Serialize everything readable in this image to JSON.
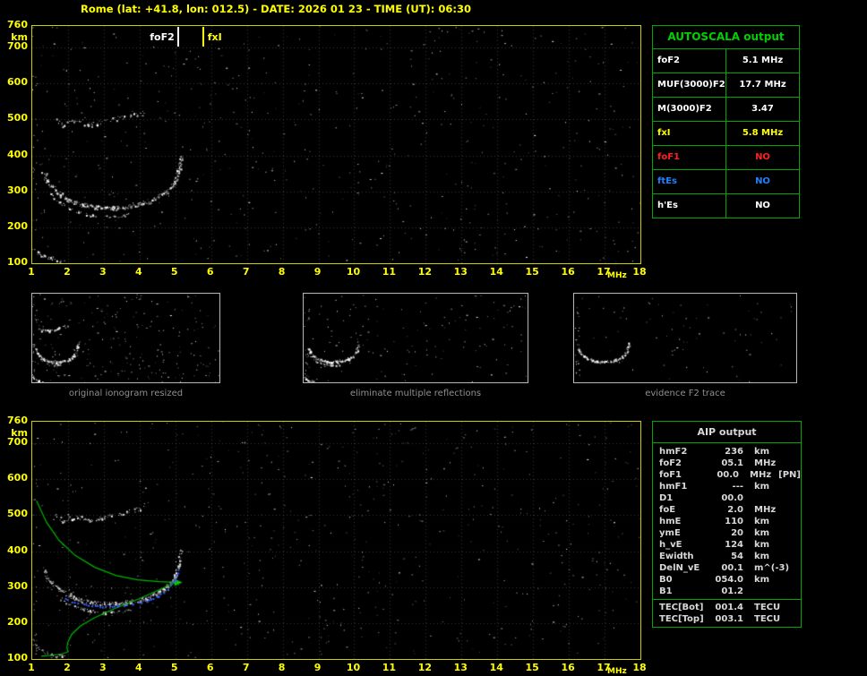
{
  "title": "Rome (lat: +41.8, lon: 012.5) - DATE: 2026 01 23 - TIME (UT): 06:30",
  "colors": {
    "axis_yellow": "#ffff00",
    "table_green": "#00a800",
    "marker_foF2": "#ffffff",
    "marker_fxI": "#ffff00",
    "profile_green": "#00b400",
    "restored_blue": "#3c5cff",
    "caption_gray": "#909090",
    "no_red": "#ff2020",
    "no_blue": "#2080ff"
  },
  "autoscala": {
    "title": "AUTOSCALA output",
    "rows": [
      {
        "label": "foF2",
        "value": "5.1 MHz",
        "color": "#ffffff"
      },
      {
        "label": "MUF(3000)F2",
        "value": "17.7 MHz",
        "color": "#ffffff"
      },
      {
        "label": "M(3000)F2",
        "value": "3.47",
        "color": "#ffffff"
      },
      {
        "label": "fxI",
        "value": "5.8 MHz",
        "color": "#ffff00"
      },
      {
        "label": "foF1",
        "value": "NO",
        "color": "#ff2020"
      },
      {
        "label": "ftEs",
        "value": "NO",
        "color": "#2080ff"
      },
      {
        "label": "h'Es",
        "value": "NO",
        "color": "#ffffff"
      }
    ]
  },
  "thumbnails": [
    {
      "caption": "original ionogram resized"
    },
    {
      "caption": "eliminate multiple reflections"
    },
    {
      "caption": "evidence F2 trace"
    }
  ],
  "aip": {
    "title": "AIP output",
    "rows": [
      {
        "label": "hmF2",
        "value": "236",
        "unit": "km",
        "extra": ""
      },
      {
        "label": "foF2",
        "value": "05.1",
        "unit": "MHz",
        "extra": ""
      },
      {
        "label": "foF1",
        "value": "00.0",
        "unit": "MHz",
        "extra": "[PN]"
      },
      {
        "label": "hmF1",
        "value": "---",
        "unit": "km",
        "extra": ""
      },
      {
        "label": "D1",
        "value": "00.0",
        "unit": "",
        "extra": ""
      },
      {
        "label": "foE",
        "value": "2.0",
        "unit": "MHz",
        "extra": ""
      },
      {
        "label": "hmE",
        "value": "110",
        "unit": "km",
        "extra": ""
      },
      {
        "label": "ymE",
        "value": "20",
        "unit": "km",
        "extra": ""
      },
      {
        "label": "h_vE",
        "value": "124",
        "unit": "km",
        "extra": ""
      },
      {
        "label": "Ewidth",
        "value": "54",
        "unit": "km",
        "extra": ""
      },
      {
        "label": "DelN_vE",
        "value": "00.1",
        "unit": "m^(-3)",
        "extra": ""
      },
      {
        "label": "B0",
        "value": "054.0",
        "unit": "km",
        "extra": ""
      },
      {
        "label": "B1",
        "value": "01.2",
        "unit": "",
        "extra": ""
      }
    ],
    "tec_rows": [
      {
        "label": "TEC[Bot]",
        "value": "001.4",
        "unit": "TECU"
      },
      {
        "label": "TEC[Top]",
        "value": "003.1",
        "unit": "TECU"
      }
    ]
  },
  "chart_data": {
    "type": "scatter",
    "title": "Ionogram with AUTOSCALA / AIP interpretation",
    "xlabel": "MHz",
    "ylabel": "km",
    "xlim": [
      1,
      18
    ],
    "ylim": [
      100,
      760
    ],
    "x_ticks": [
      1,
      2,
      3,
      4,
      5,
      6,
      7,
      8,
      9,
      10,
      11,
      12,
      13,
      14,
      15,
      16,
      17,
      18
    ],
    "y_ticks": [
      760,
      700,
      600,
      500,
      400,
      300,
      200,
      100
    ],
    "grid": true,
    "markers": [
      {
        "name": "foF2",
        "freq_mhz": 5.1,
        "color": "#ffffff"
      },
      {
        "name": "fxI",
        "freq_mhz": 5.8,
        "color": "#ffff00"
      }
    ],
    "traces": {
      "multiple_reflection_hop": [
        [
          1.65,
          498
        ],
        [
          1.85,
          486
        ],
        [
          2.05,
          492
        ],
        [
          2.3,
          497
        ],
        [
          2.55,
          486
        ],
        [
          2.8,
          490
        ],
        [
          3.05,
          497
        ],
        [
          3.3,
          503
        ],
        [
          3.6,
          509
        ],
        [
          3.9,
          516
        ],
        [
          4.1,
          521
        ]
      ],
      "f_trace_main": [
        [
          1.3,
          352
        ],
        [
          1.5,
          318
        ],
        [
          1.75,
          295
        ],
        [
          2.05,
          276
        ],
        [
          2.4,
          263
        ],
        [
          2.8,
          256
        ],
        [
          3.2,
          254
        ],
        [
          3.6,
          257
        ],
        [
          4.0,
          264
        ],
        [
          4.4,
          278
        ],
        [
          4.7,
          296
        ],
        [
          4.95,
          322
        ],
        [
          5.1,
          362
        ],
        [
          5.16,
          400
        ]
      ],
      "f_trace_inner": [
        [
          1.45,
          302
        ],
        [
          1.7,
          274
        ],
        [
          2.0,
          254
        ],
        [
          2.35,
          241
        ],
        [
          2.7,
          233
        ],
        [
          3.05,
          230
        ],
        [
          3.4,
          231
        ],
        [
          3.75,
          237
        ]
      ],
      "e_region": [
        [
          1.02,
          142
        ],
        [
          1.15,
          130
        ],
        [
          1.3,
          121
        ],
        [
          1.5,
          114
        ],
        [
          1.7,
          110
        ],
        [
          1.85,
          108
        ]
      ]
    },
    "overlays": {
      "restored_trace_blue": [
        [
          1.85,
          268
        ],
        [
          2.2,
          256
        ],
        [
          2.6,
          248
        ],
        [
          3.0,
          245
        ],
        [
          3.4,
          246
        ],
        [
          3.8,
          251
        ],
        [
          4.2,
          260
        ],
        [
          4.55,
          274
        ],
        [
          4.8,
          292
        ],
        [
          5.0,
          318
        ],
        [
          5.12,
          352
        ]
      ],
      "electron_density_profile_green": {
        "topside": [
          [
            1.12,
            540
          ],
          [
            1.4,
            480
          ],
          [
            1.75,
            430
          ],
          [
            2.2,
            388
          ],
          [
            2.75,
            355
          ],
          [
            3.35,
            332
          ],
          [
            3.95,
            320
          ],
          [
            4.55,
            315
          ],
          [
            5.0,
            313
          ]
        ],
        "bottomside": [
          [
            5.0,
            313
          ],
          [
            4.6,
            295
          ],
          [
            4.0,
            268
          ],
          [
            3.3,
            240
          ],
          [
            2.75,
            215
          ],
          [
            2.35,
            192
          ],
          [
            2.1,
            168
          ],
          [
            2.0,
            148
          ],
          [
            1.97,
            132
          ],
          [
            2.0,
            120
          ],
          [
            1.8,
            113
          ],
          [
            1.5,
            110
          ],
          [
            1.25,
            108
          ]
        ]
      }
    }
  }
}
